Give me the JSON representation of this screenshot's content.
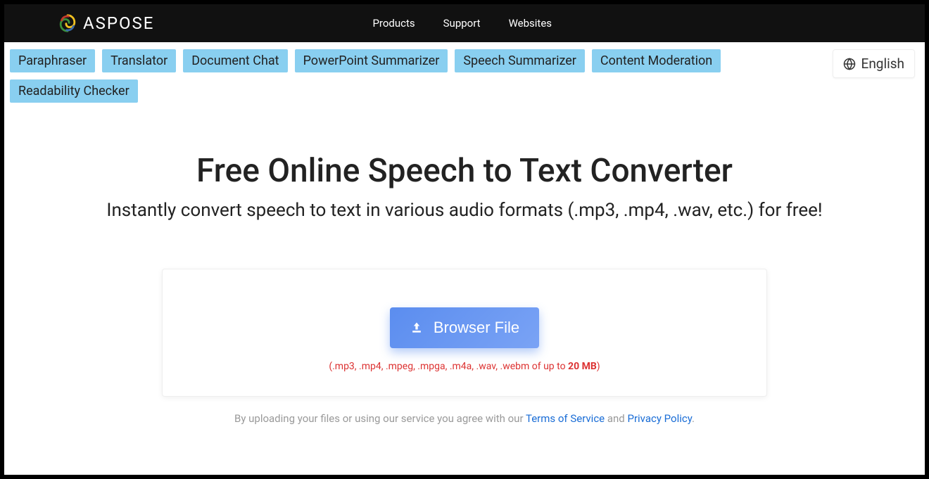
{
  "brand": {
    "name": "ASPOSE"
  },
  "nav": {
    "products": "Products",
    "support": "Support",
    "websites": "Websites"
  },
  "tools": {
    "paraphraser": "Paraphraser",
    "translator": "Translator",
    "document_chat": "Document Chat",
    "powerpoint_summarizer": "PowerPoint Summarizer",
    "speech_summarizer": "Speech Summarizer",
    "content_moderation": "Content Moderation",
    "readability_checker": "Readability Checker"
  },
  "lang": {
    "label": "English"
  },
  "hero": {
    "title": "Free Online Speech to Text Converter",
    "subtitle": "Instantly convert speech to text in various audio formats (.mp3, .mp4, .wav, etc.) for free!"
  },
  "upload": {
    "button_label": "Browser File",
    "formats_prefix": "(.mp3, .mp4, .mpeg, .mpga, .m4a, .wav, .webm of up to ",
    "formats_limit": "20 MB",
    "formats_suffix": ")"
  },
  "terms": {
    "prefix": "By uploading your files or using our service you agree with our ",
    "tos": "Terms of Service",
    "and": " and ",
    "privacy": "Privacy Policy",
    "dot": "."
  }
}
